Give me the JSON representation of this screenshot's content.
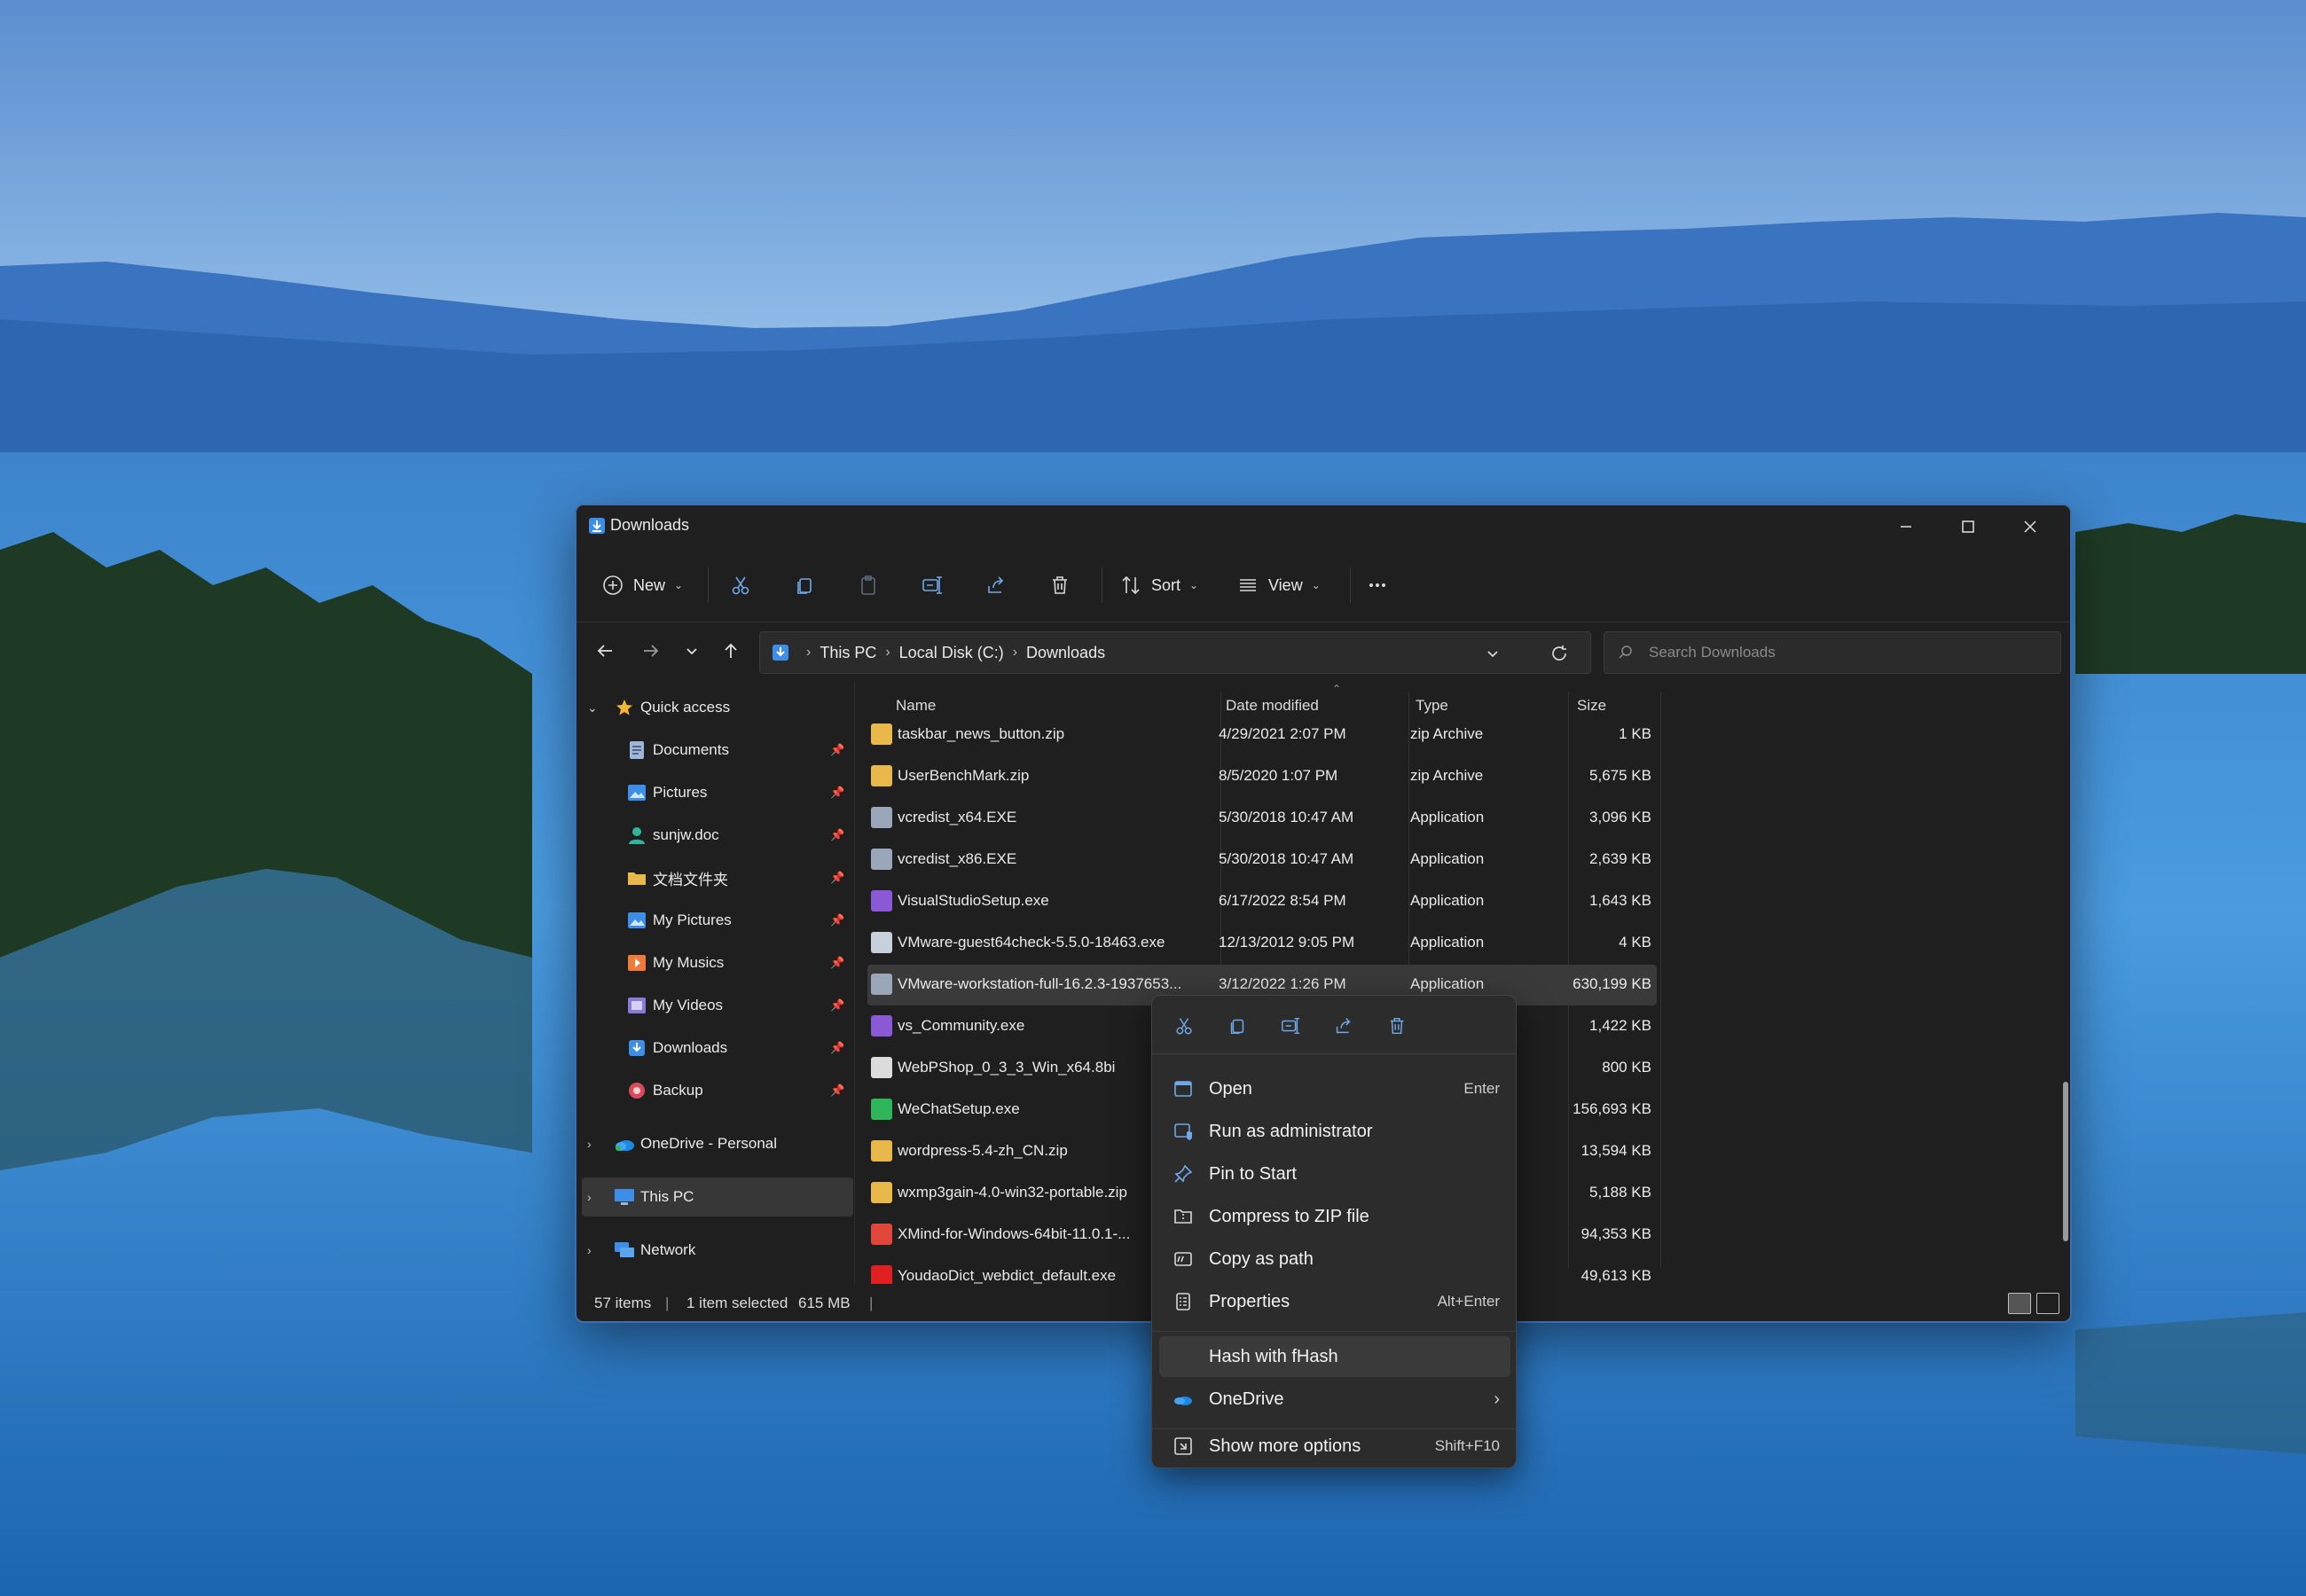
{
  "window": {
    "title": "Downloads",
    "controls": [
      "minimize-icon",
      "maximize-icon",
      "close-icon"
    ]
  },
  "toolbar": {
    "new_label": "New",
    "sort_label": "Sort",
    "view_label": "View",
    "icons": [
      "cut-icon",
      "copy-icon",
      "paste-icon",
      "rename-icon",
      "share-icon",
      "delete-icon",
      "more-icon"
    ]
  },
  "address": {
    "crumbs": [
      "This PC",
      "Local Disk (C:)",
      "Downloads"
    ]
  },
  "search": {
    "placeholder": "Search Downloads"
  },
  "sidebar": {
    "quick_access": "Quick access",
    "items": [
      {
        "label": "Documents",
        "icon": "documents-icon",
        "color": "#9fb6d9"
      },
      {
        "label": "Pictures",
        "icon": "pictures-icon",
        "color": "#3d8ee8"
      },
      {
        "label": "sunjw.doc",
        "icon": "user-icon",
        "color": "#2fb59b"
      },
      {
        "label": "文档文件夹",
        "icon": "folder-icon",
        "color": "#e8b84a"
      },
      {
        "label": "My Pictures",
        "icon": "pictures-icon",
        "color": "#3d8ee8"
      },
      {
        "label": "My Musics",
        "icon": "music-icon",
        "color": "#f07a3a"
      },
      {
        "label": "My Videos",
        "icon": "videos-icon",
        "color": "#8a7ad6"
      },
      {
        "label": "Downloads",
        "icon": "downloads-icon",
        "color": "#3d8ee8"
      },
      {
        "label": "Backup",
        "icon": "backup-icon",
        "color": "#d94a5a"
      }
    ],
    "onedrive": "OneDrive - Personal",
    "this_pc": "This PC",
    "network": "Network"
  },
  "columns": {
    "name": "Name",
    "date": "Date modified",
    "type": "Type",
    "size": "Size"
  },
  "files": [
    {
      "name": "taskbar_news_button.zip",
      "date": "4/29/2021 2:07 PM",
      "type": "zip Archive",
      "size": "1 KB",
      "icon_color": "#e8b84a"
    },
    {
      "name": "UserBenchMark.zip",
      "date": "8/5/2020 1:07 PM",
      "type": "zip Archive",
      "size": "5,675 KB",
      "icon_color": "#e8b84a"
    },
    {
      "name": "vcredist_x64.EXE",
      "date": "5/30/2018 10:47 AM",
      "type": "Application",
      "size": "3,096 KB",
      "icon_color": "#9aa7b8"
    },
    {
      "name": "vcredist_x86.EXE",
      "date": "5/30/2018 10:47 AM",
      "type": "Application",
      "size": "2,639 KB",
      "icon_color": "#9aa7b8"
    },
    {
      "name": "VisualStudioSetup.exe",
      "date": "6/17/2022 8:54 PM",
      "type": "Application",
      "size": "1,643 KB",
      "icon_color": "#8a5ad6"
    },
    {
      "name": "VMware-guest64check-5.5.0-18463.exe",
      "date": "12/13/2012 9:05 PM",
      "type": "Application",
      "size": "4 KB",
      "icon_color": "#c8d0dc"
    },
    {
      "name": "VMware-workstation-full-16.2.3-1937653...",
      "date": "3/12/2022 1:26 PM",
      "type": "Application",
      "size": "630,199 KB",
      "icon_color": "#9aa7b8"
    },
    {
      "name": "vs_Community.exe",
      "date": "",
      "type": "",
      "size": "1,422 KB",
      "icon_color": "#8a5ad6"
    },
    {
      "name": "WebPShop_0_3_3_Win_x64.8bi",
      "date": "",
      "type": "",
      "size": "800 KB",
      "icon_color": "#dcdcdc"
    },
    {
      "name": "WeChatSetup.exe",
      "date": "",
      "type": "",
      "size": "156,693 KB",
      "icon_color": "#2fb55a"
    },
    {
      "name": "wordpress-5.4-zh_CN.zip",
      "date": "",
      "type": "",
      "size": "13,594 KB",
      "icon_color": "#e8b84a"
    },
    {
      "name": "wxmp3gain-4.0-win32-portable.zip",
      "date": "",
      "type": "",
      "size": "5,188 KB",
      "icon_color": "#e8b84a"
    },
    {
      "name": "XMind-for-Windows-64bit-11.0.1-...",
      "date": "",
      "type": "",
      "size": "94,353 KB",
      "icon_color": "#e0463a"
    },
    {
      "name": "YoudaoDict_webdict_default.exe",
      "date": "",
      "type": "",
      "size": "49,613 KB",
      "icon_color": "#e02020"
    }
  ],
  "status": {
    "items": "57 items",
    "selected": "1 item selected",
    "size": "615 MB"
  },
  "context_menu": {
    "quick_icons": [
      "cut-icon",
      "copy-icon",
      "rename-icon",
      "share-icon",
      "delete-icon"
    ],
    "items": [
      {
        "label": "Open",
        "shortcut": "Enter",
        "icon": "open-icon"
      },
      {
        "label": "Run as administrator",
        "shortcut": "",
        "icon": "shield-icon"
      },
      {
        "label": "Pin to Start",
        "shortcut": "",
        "icon": "pin-icon"
      },
      {
        "label": "Compress to ZIP file",
        "shortcut": "",
        "icon": "zip-icon"
      },
      {
        "label": "Copy as path",
        "shortcut": "",
        "icon": "copy-path-icon"
      },
      {
        "label": "Properties",
        "shortcut": "Alt+Enter",
        "icon": "properties-icon"
      },
      {
        "label": "Hash with fHash",
        "shortcut": "",
        "icon": ""
      },
      {
        "label": "OneDrive",
        "shortcut": "",
        "icon": "onedrive-icon"
      },
      {
        "label": "Show more options",
        "shortcut": "Shift+F10",
        "icon": "more-options-icon"
      }
    ]
  },
  "colors": {
    "accent": "#3d8ee8",
    "window_bg": "#1f1f1f",
    "menu_bg": "#2c2c2c",
    "selection": "#3a3a3a"
  }
}
